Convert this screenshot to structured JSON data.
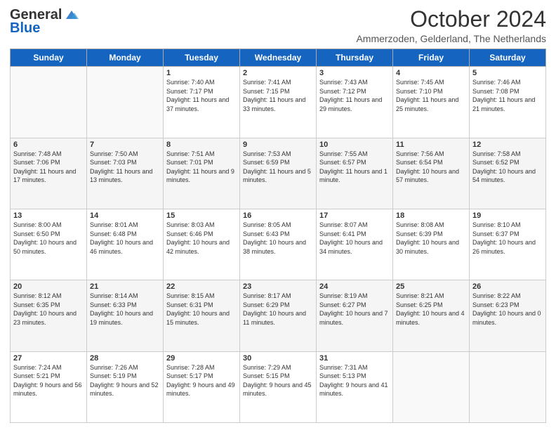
{
  "logo": {
    "line1": "General",
    "line2": "Blue"
  },
  "title": "October 2024",
  "location": "Ammerzoden, Gelderland, The Netherlands",
  "days_of_week": [
    "Sunday",
    "Monday",
    "Tuesday",
    "Wednesday",
    "Thursday",
    "Friday",
    "Saturday"
  ],
  "weeks": [
    [
      {
        "day": "",
        "content": ""
      },
      {
        "day": "",
        "content": ""
      },
      {
        "day": "1",
        "content": "Sunrise: 7:40 AM\nSunset: 7:17 PM\nDaylight: 11 hours and 37 minutes."
      },
      {
        "day": "2",
        "content": "Sunrise: 7:41 AM\nSunset: 7:15 PM\nDaylight: 11 hours and 33 minutes."
      },
      {
        "day": "3",
        "content": "Sunrise: 7:43 AM\nSunset: 7:12 PM\nDaylight: 11 hours and 29 minutes."
      },
      {
        "day": "4",
        "content": "Sunrise: 7:45 AM\nSunset: 7:10 PM\nDaylight: 11 hours and 25 minutes."
      },
      {
        "day": "5",
        "content": "Sunrise: 7:46 AM\nSunset: 7:08 PM\nDaylight: 11 hours and 21 minutes."
      }
    ],
    [
      {
        "day": "6",
        "content": "Sunrise: 7:48 AM\nSunset: 7:06 PM\nDaylight: 11 hours and 17 minutes."
      },
      {
        "day": "7",
        "content": "Sunrise: 7:50 AM\nSunset: 7:03 PM\nDaylight: 11 hours and 13 minutes."
      },
      {
        "day": "8",
        "content": "Sunrise: 7:51 AM\nSunset: 7:01 PM\nDaylight: 11 hours and 9 minutes."
      },
      {
        "day": "9",
        "content": "Sunrise: 7:53 AM\nSunset: 6:59 PM\nDaylight: 11 hours and 5 minutes."
      },
      {
        "day": "10",
        "content": "Sunrise: 7:55 AM\nSunset: 6:57 PM\nDaylight: 11 hours and 1 minute."
      },
      {
        "day": "11",
        "content": "Sunrise: 7:56 AM\nSunset: 6:54 PM\nDaylight: 10 hours and 57 minutes."
      },
      {
        "day": "12",
        "content": "Sunrise: 7:58 AM\nSunset: 6:52 PM\nDaylight: 10 hours and 54 minutes."
      }
    ],
    [
      {
        "day": "13",
        "content": "Sunrise: 8:00 AM\nSunset: 6:50 PM\nDaylight: 10 hours and 50 minutes."
      },
      {
        "day": "14",
        "content": "Sunrise: 8:01 AM\nSunset: 6:48 PM\nDaylight: 10 hours and 46 minutes."
      },
      {
        "day": "15",
        "content": "Sunrise: 8:03 AM\nSunset: 6:46 PM\nDaylight: 10 hours and 42 minutes."
      },
      {
        "day": "16",
        "content": "Sunrise: 8:05 AM\nSunset: 6:43 PM\nDaylight: 10 hours and 38 minutes."
      },
      {
        "day": "17",
        "content": "Sunrise: 8:07 AM\nSunset: 6:41 PM\nDaylight: 10 hours and 34 minutes."
      },
      {
        "day": "18",
        "content": "Sunrise: 8:08 AM\nSunset: 6:39 PM\nDaylight: 10 hours and 30 minutes."
      },
      {
        "day": "19",
        "content": "Sunrise: 8:10 AM\nSunset: 6:37 PM\nDaylight: 10 hours and 26 minutes."
      }
    ],
    [
      {
        "day": "20",
        "content": "Sunrise: 8:12 AM\nSunset: 6:35 PM\nDaylight: 10 hours and 23 minutes."
      },
      {
        "day": "21",
        "content": "Sunrise: 8:14 AM\nSunset: 6:33 PM\nDaylight: 10 hours and 19 minutes."
      },
      {
        "day": "22",
        "content": "Sunrise: 8:15 AM\nSunset: 6:31 PM\nDaylight: 10 hours and 15 minutes."
      },
      {
        "day": "23",
        "content": "Sunrise: 8:17 AM\nSunset: 6:29 PM\nDaylight: 10 hours and 11 minutes."
      },
      {
        "day": "24",
        "content": "Sunrise: 8:19 AM\nSunset: 6:27 PM\nDaylight: 10 hours and 7 minutes."
      },
      {
        "day": "25",
        "content": "Sunrise: 8:21 AM\nSunset: 6:25 PM\nDaylight: 10 hours and 4 minutes."
      },
      {
        "day": "26",
        "content": "Sunrise: 8:22 AM\nSunset: 6:23 PM\nDaylight: 10 hours and 0 minutes."
      }
    ],
    [
      {
        "day": "27",
        "content": "Sunrise: 7:24 AM\nSunset: 5:21 PM\nDaylight: 9 hours and 56 minutes."
      },
      {
        "day": "28",
        "content": "Sunrise: 7:26 AM\nSunset: 5:19 PM\nDaylight: 9 hours and 52 minutes."
      },
      {
        "day": "29",
        "content": "Sunrise: 7:28 AM\nSunset: 5:17 PM\nDaylight: 9 hours and 49 minutes."
      },
      {
        "day": "30",
        "content": "Sunrise: 7:29 AM\nSunset: 5:15 PM\nDaylight: 9 hours and 45 minutes."
      },
      {
        "day": "31",
        "content": "Sunrise: 7:31 AM\nSunset: 5:13 PM\nDaylight: 9 hours and 41 minutes."
      },
      {
        "day": "",
        "content": ""
      },
      {
        "day": "",
        "content": ""
      }
    ]
  ]
}
